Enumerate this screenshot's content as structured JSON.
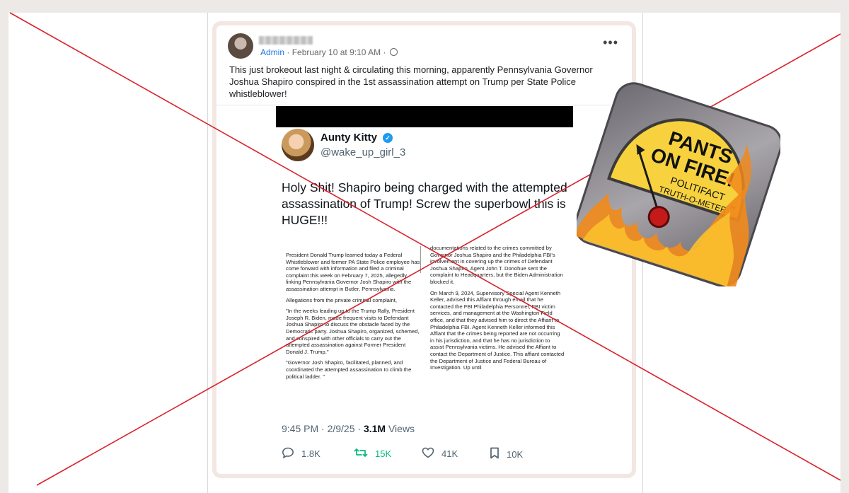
{
  "post": {
    "role_badge": "Admin",
    "timestamp": "February 10 at 9:10 AM",
    "separator": "·",
    "more_label": "•••",
    "text": "This just brokeout last night & circulating this morning, apparently Pennsylvania Governor Joshua Shapiro conspired in the 1st assassination attempt on Trump per State Police whistleblower!"
  },
  "tweet": {
    "display_name": "Aunty Kitty",
    "handle": "@wake_up_girl_3",
    "text": "Holy Shit! Shapiro being charged with the attempted assassination of Trump! Screw the superbowl this is HUGE!!!",
    "time": "9:45 PM · 2/9/25 · ",
    "views_count": "3.1M",
    "views_label": " Views",
    "actions": {
      "replies": "1.8K",
      "retweets": "15K",
      "likes": "41K",
      "bookmarks": "10K"
    },
    "document": {
      "left": [
        "President Donald Trump learned today a Federal Whistleblower and former PA State Police employee has come forward with information and filed a criminal complaint this week on February 7, 2025, allegedly linking Pennsylvania Governor Josh Shapiro with the assassination attempt in Butler, Pennsylvania.",
        "Allegations from the private criminal complaint,",
        "\"In the weeks leading up to the Trump Rally, President Joseph R. Biden, made frequent visits to Defendant Joshua Shapiro to discuss the obstacle faced by the Democratic party. Joshua Shapiro, organized, schemed, and conspired with other officials to carry out the attempted assassination against Former President Donald J. Trump.\"",
        "\"Governor Josh Shapiro, facilitated, planned, and coordinated the attempted assassination to climb the political ladder. \""
      ],
      "right": [
        "documentations related to the crimes committed by Governor Joshua Shapiro and the Philadelphia FBI's involvement in covering up the crimes of Defendant Joshua Shapiro. Agent John T. Donohue sent the complaint to Headquarters, but the Biden Administration blocked it.",
        "On March 9, 2024, Supervisory Special Agent Kenneth Keller, advised this Affiant through email that he contacted the FBI Philadelphia Personnel, FBI victim services, and management at the Washington Field office, and that they advised him to direct the Affiant to Philadelphia FBI. Agent Kenneth Keller informed this Affiant that the crimes being reported are not occurring in his jurisdiction, and that he has no jurisdiction to assist Pennsylvania victims. He advised the Affiant to contact the Department of Justice. This affiant contacted the Department of Justice and Federal Bureau of Investigation. Up until"
      ]
    }
  },
  "rating_badge": {
    "line1": "PANTS",
    "line2": "ON FIRE!",
    "brand": "POLITIFACT",
    "meter": "TRUTH-O-METER",
    "trademark": "™",
    "colors": {
      "face": "#f7d23e",
      "frame": "#8c8a8f",
      "fire": "#f08a1c",
      "needle": "#1a1a1a"
    }
  },
  "colors": {
    "cross_line": "#d9232d",
    "retweet_green": "#00ba7c",
    "fb_blue": "#1b74e4",
    "verified_blue": "#1d9bf0"
  }
}
